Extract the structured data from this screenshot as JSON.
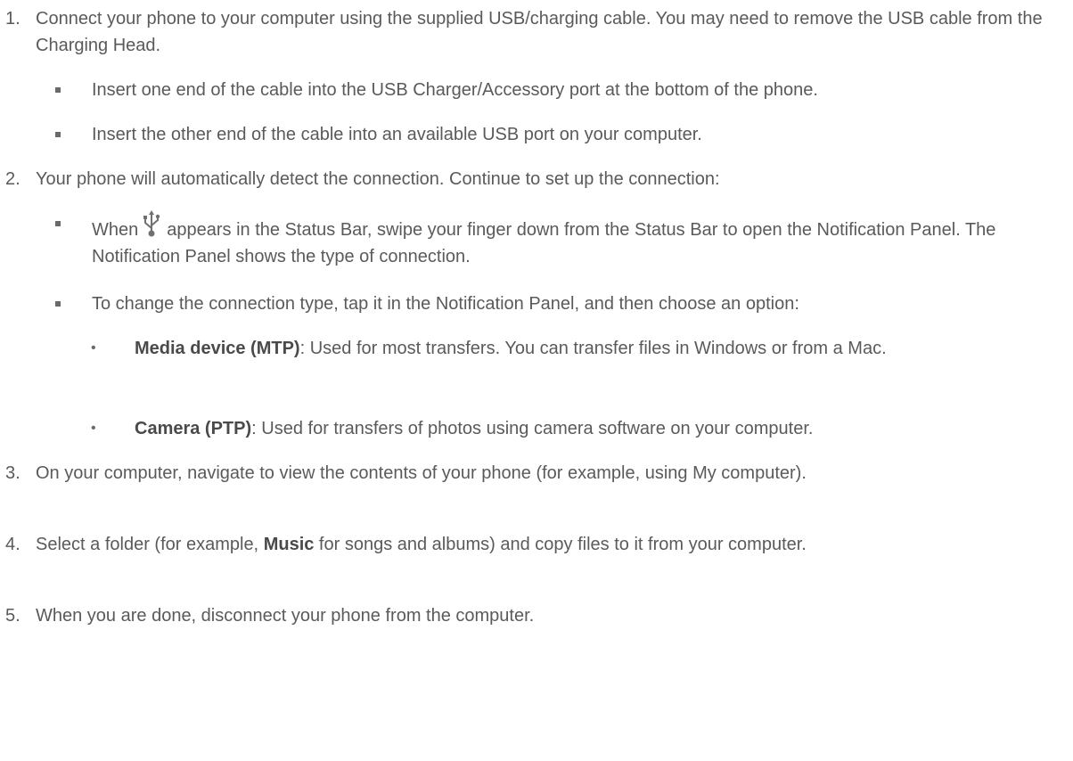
{
  "steps": [
    {
      "number": "1.",
      "text": "Connect your phone to your computer using the supplied USB/charging cable. You may need to remove the USB cable from the Charging Head.",
      "sub_items": [
        "Insert one end of the cable into the USB Charger/Accessory port at the bottom of the phone.",
        "Insert the other end of the cable into an available USB port on your computer."
      ]
    },
    {
      "number": "2.",
      "text": "Your phone will automatically detect the connection. Continue to set up the connection:",
      "sub_items": [
        {
          "before_icon": "When",
          "icon": "usb-icon",
          "after_icon": "appears in the Status Bar, swipe your finger down from the Status Bar to open the Notification Panel. The Notification Panel shows the type of connection."
        },
        {
          "text": "To change the connection type, tap it in the Notification Panel, and then choose an option:",
          "options": [
            {
              "label": "Media device (MTP)",
              "description": ": Used for most transfers. You can transfer files in Windows or from a Mac."
            },
            {
              "label": "Camera (PTP)",
              "description": ": Used for transfers of photos using camera software on your computer."
            }
          ]
        }
      ]
    },
    {
      "number": "3.",
      "text": "On your computer, navigate to view the contents of your phone (for example, using My computer)."
    },
    {
      "number": "4.",
      "text_before": "Select a folder (for example, ",
      "bold": "Music",
      "text_after": " for songs and albums) and copy files to it from your computer."
    },
    {
      "number": "5.",
      "text": "When you are done, disconnect your phone from the computer."
    }
  ]
}
